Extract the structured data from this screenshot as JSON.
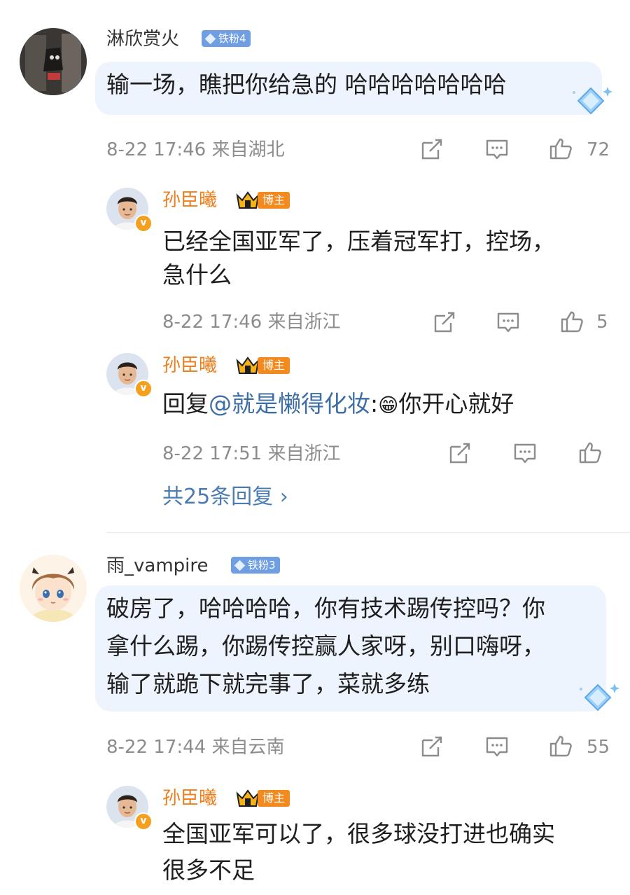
{
  "comments": [
    {
      "username": "淋欣赏火",
      "fan_badge": "铁粉4",
      "text": "输一场，瞧把你给急的 哈哈哈哈哈哈哈",
      "time": "8-22 17:46",
      "location": "来自湖北",
      "likes": "72",
      "replies": [
        {
          "username": "孙臣曦",
          "badge": "博主",
          "lines": [
            "已经全国亚军了，压着冠军打，控场，",
            "急什么"
          ],
          "time": "8-22 17:46",
          "location": "来自浙江",
          "likes": "5"
        },
        {
          "username": "孙臣曦",
          "badge": "博主",
          "reply_prefix": "回复",
          "mention": "@就是懒得化妆",
          "colon": ":",
          "emoji": "😁",
          "text": "你开心就好",
          "time": "8-22 17:51",
          "location": "来自浙江"
        }
      ],
      "more_replies": "共25条回复 ›"
    },
    {
      "username": "雨_vampire",
      "fan_badge": "铁粉3",
      "lines": [
        "破房了，哈哈哈哈，你有技术踢传控吗？你",
        "拿什么踢，你踢传控赢人家呀，别口嗨呀，",
        "输了就跪下就完事了，菜就多练"
      ],
      "time": "8-22 17:44",
      "location": "来自云南",
      "likes": "55",
      "replies": [
        {
          "username": "孙臣曦",
          "badge": "博主",
          "lines": [
            "全国亚军可以了，很多球没打进也确实",
            "很多不足"
          ]
        }
      ]
    }
  ],
  "colors": {
    "blogger_name": "#ef7d1a",
    "mention": "#3d6ea6",
    "more_link": "#4a7cb3",
    "bubble": "#eef4fd",
    "fan_badge": "#6f9ee3",
    "blogger_badge": "#f38a1e"
  },
  "icons": [
    "repost-icon",
    "comment-icon",
    "like-icon",
    "diamond-sparkle-icon",
    "crown-icon",
    "verified-v-icon"
  ]
}
